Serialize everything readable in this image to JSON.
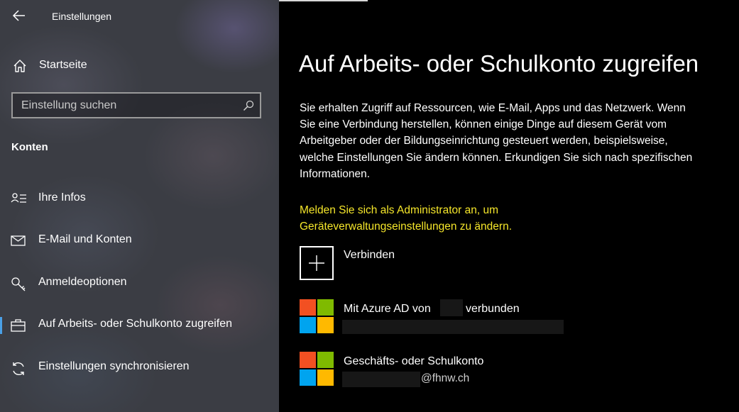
{
  "colors": {
    "accent": "#4aa0e6",
    "admin_link": "#f5e62a",
    "ms_red": "#f25022",
    "ms_green": "#7fba00",
    "ms_blue": "#00a4ef",
    "ms_yellow": "#ffb900"
  },
  "sidebar": {
    "back_icon": "arrow-left-icon",
    "title": "Einstellungen",
    "home": {
      "label": "Startseite",
      "icon": "home-icon"
    },
    "search": {
      "placeholder": "Einstellung suchen",
      "value": "",
      "icon": "search-icon"
    },
    "section": "Konten",
    "items": [
      {
        "label": "Ihre Infos",
        "icon": "person-card-icon",
        "active": false
      },
      {
        "label": "E-Mail und Konten",
        "icon": "envelope-icon",
        "active": false
      },
      {
        "label": "Anmeldeoptionen",
        "icon": "key-icon",
        "active": false
      },
      {
        "label": "Auf Arbeits- oder Schulkonto zugreifen",
        "icon": "briefcase-icon",
        "active": true
      },
      {
        "label": "Einstellungen synchronisieren",
        "icon": "sync-icon",
        "active": false
      }
    ]
  },
  "main": {
    "title": "Auf Arbeits- oder Schulkonto zugreifen",
    "description": "Sie erhalten Zugriff auf Ressourcen, wie E-Mail, Apps und das Netzwerk. Wenn Sie eine Verbindung herstellen, können einige Dinge auf diesem Gerät vom Arbeitgeber oder der Bildungseinrichtung gesteuert werden, beispielsweise, welche Einstellungen Sie ändern können. Erkundigen Sie sich nach spezifischen Informationen.",
    "admin_link": "Melden Sie sich als Administrator an, um Geräteverwaltungseinstellungen zu ändern.",
    "connect": {
      "label": "Verbinden",
      "icon": "plus-icon"
    },
    "accounts": [
      {
        "icon": "microsoft-logo-icon",
        "title_prefix": "Mit Azure AD von",
        "title_suffix": "verbunden",
        "subtitle": ""
      },
      {
        "icon": "microsoft-logo-icon",
        "title": "Geschäfts- oder Schulkonto",
        "subtitle_domain": "@fhnw.ch"
      }
    ]
  }
}
